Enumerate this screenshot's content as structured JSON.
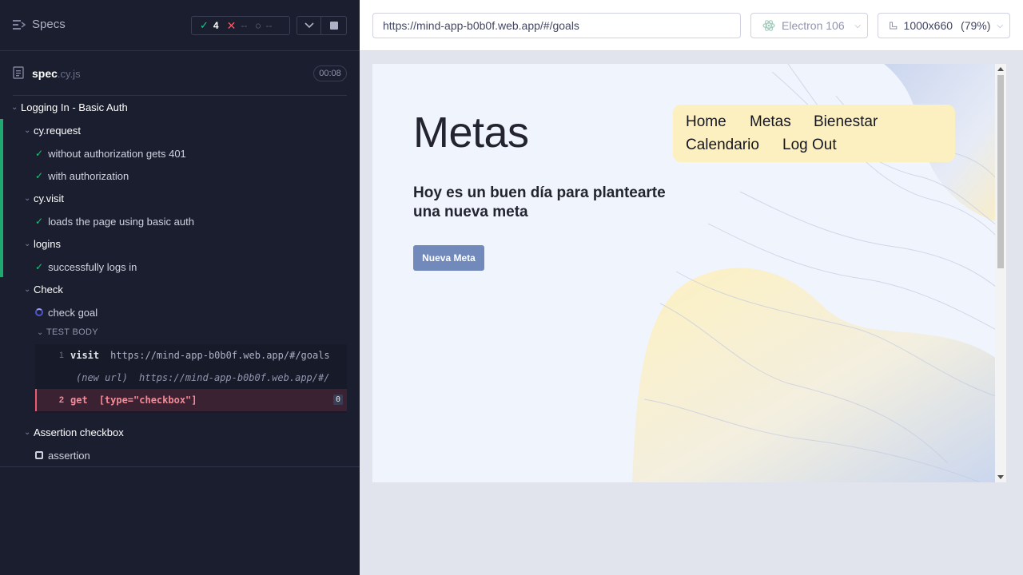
{
  "reporter": {
    "specs_label": "Specs",
    "stats": {
      "passed": "4",
      "failed": "--",
      "pending": "--"
    },
    "spec_file": {
      "name": "spec",
      "ext": ".cy.js",
      "duration": "00:08"
    },
    "root_suite": "Logging In - Basic Auth",
    "suites": [
      {
        "title": "cy.request",
        "tests": [
          "without authorization gets 401",
          "with authorization"
        ]
      },
      {
        "title": "cy.visit",
        "tests": [
          "loads the page using basic auth"
        ]
      },
      {
        "title": "logins",
        "tests": [
          "successfully logs in"
        ]
      },
      {
        "title": "Check",
        "tests": [
          "check goal"
        ]
      },
      {
        "title": "Assertion checkbox",
        "tests": [
          "assertion"
        ]
      }
    ],
    "test_body_label": "TEST BODY",
    "commands": [
      {
        "num": "1",
        "name": "visit",
        "message": "https://mind-app-b0b0f.web.app/#/goals"
      },
      {
        "num": "",
        "name": "(new url)",
        "message": "https://mind-app-b0b0f.web.app/#/"
      },
      {
        "num": "2",
        "name": "get",
        "message": "[type=\"checkbox\"]",
        "count": "0"
      }
    ]
  },
  "aut": {
    "url": "https://mind-app-b0b0f.web.app/#/goals",
    "browser": "Electron 106",
    "viewport": "1000x660",
    "zoom": "(79%)"
  },
  "app": {
    "title": "Metas",
    "subtitle": "Hoy es un buen día para plantearte una nueva meta",
    "new_goal_button": "Nueva Meta",
    "nav": [
      "Home",
      "Metas",
      "Bienestar",
      "Calendario",
      "Log Out"
    ]
  },
  "colors": {
    "reporter_bg": "#1b1e2e",
    "pass": "#1fc37a",
    "fail": "#f05a6c",
    "nav_bg": "#fdf0c0",
    "button_bg": "#7289bb"
  }
}
